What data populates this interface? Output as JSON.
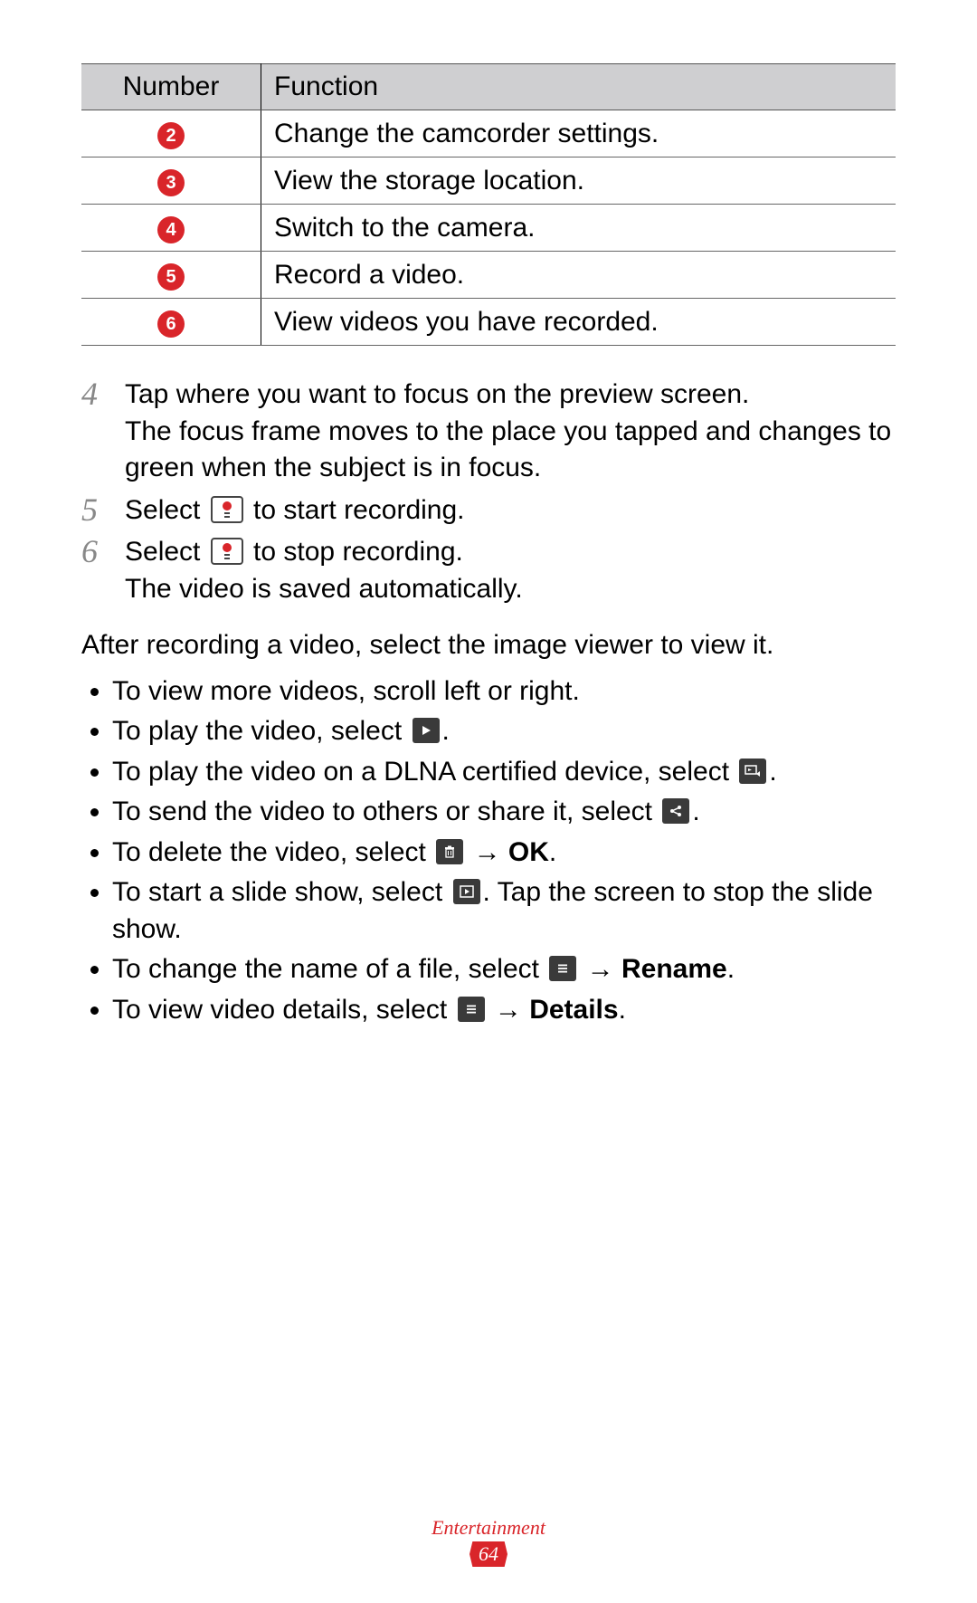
{
  "table": {
    "headers": {
      "number": "Number",
      "function": "Function"
    },
    "rows": [
      {
        "n": "2",
        "fn": "Change the camcorder settings."
      },
      {
        "n": "3",
        "fn": "View the storage location."
      },
      {
        "n": "4",
        "fn": "Switch to the camera."
      },
      {
        "n": "5",
        "fn": "Record a video."
      },
      {
        "n": "6",
        "fn": "View videos you have recorded."
      }
    ]
  },
  "steps": {
    "s4": {
      "num": "4",
      "line1": "Tap where you want to focus on the preview screen.",
      "line2": "The focus frame moves to the place you tapped and changes to green when the subject is in focus."
    },
    "s5": {
      "num": "5",
      "pre": "Select ",
      "post": " to start recording."
    },
    "s6": {
      "num": "6",
      "pre": "Select ",
      "post": " to stop recording.",
      "line2": "The video is saved automatically."
    }
  },
  "after": "After recording a video, select the image viewer to view it.",
  "bullets": {
    "b1": "To view more videos, scroll left or right.",
    "b2_pre": "To play the video, select ",
    "b2_post": ".",
    "b3_pre": "To play the video on a DLNA certified device, select ",
    "b3_post": ".",
    "b4_pre": "To send the video to others or share it, select ",
    "b4_post": ".",
    "b5_pre": "To delete the video, select ",
    "b5_arrow": " → ",
    "b5_bold": "OK",
    "b5_post": ".",
    "b6_pre": "To start a slide show, select ",
    "b6_post": ". Tap the screen to stop the slide show.",
    "b7_pre": "To change the name of a file, select ",
    "b7_arrow": " → ",
    "b7_bold": "Rename",
    "b7_post": ".",
    "b8_pre": "To view video details, select ",
    "b8_arrow": " → ",
    "b8_bold": "Details",
    "b8_post": "."
  },
  "footer": {
    "section": "Entertainment",
    "page": "64"
  }
}
